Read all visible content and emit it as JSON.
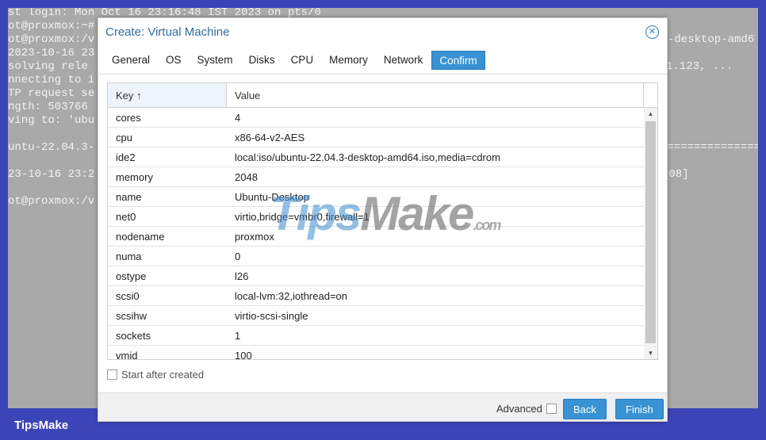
{
  "terminal": {
    "lines_left": [
      "st login: Mon Oct 16 23:16:48 IST 2023 on pts/0",
      "ot@proxmox:~#",
      "ot@proxmox:/v",
      "2023-10-16 23",
      "solving rele",
      "nnecting to i",
      "TP request se",
      "ngth: 503766",
      "ving to: 'ubu",
      "",
      "untu-22.04.3-",
      "",
      "23-10-16 23:2",
      "",
      "ot@proxmox:/v"
    ],
    "right_fragments": [
      "-desktop-amd6",
      "1.123, ...",
      "================",
      "208]"
    ]
  },
  "dialog": {
    "title": "Create: Virtual Machine",
    "tabs": [
      "General",
      "OS",
      "System",
      "Disks",
      "CPU",
      "Memory",
      "Network",
      "Confirm"
    ],
    "active_tab": "Confirm",
    "columns": {
      "key": "Key ↑",
      "value": "Value"
    },
    "rows": [
      {
        "key": "cores",
        "value": "4"
      },
      {
        "key": "cpu",
        "value": "x86-64-v2-AES"
      },
      {
        "key": "ide2",
        "value": "local:iso/ubuntu-22.04.3-desktop-amd64.iso,media=cdrom"
      },
      {
        "key": "memory",
        "value": "2048"
      },
      {
        "key": "name",
        "value": "Ubuntu-Desktop"
      },
      {
        "key": "net0",
        "value": "virtio,bridge=vmbr0,firewall=1"
      },
      {
        "key": "nodename",
        "value": "proxmox"
      },
      {
        "key": "numa",
        "value": "0"
      },
      {
        "key": "ostype",
        "value": "l26"
      },
      {
        "key": "scsi0",
        "value": "local-lvm:32,iothread=on"
      },
      {
        "key": "scsihw",
        "value": "virtio-scsi-single"
      },
      {
        "key": "sockets",
        "value": "1"
      },
      {
        "key": "vmid",
        "value": "100"
      }
    ],
    "start_after_created": "Start after created",
    "advanced": "Advanced",
    "back": "Back",
    "finish": "Finish"
  },
  "watermark": {
    "tips": "Tips",
    "make": "Make",
    ".com": ".com"
  },
  "brand": "TipsMake"
}
